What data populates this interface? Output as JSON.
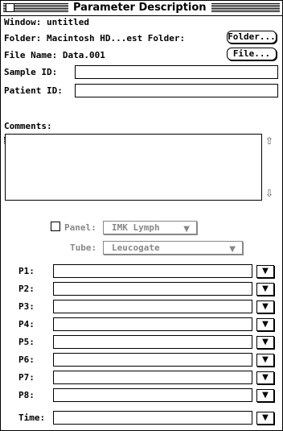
{
  "window": {
    "title": "Parameter Description"
  },
  "info": {
    "window_label": "Window: untitled",
    "folder_label": "Folder: Macintosh HD...est Folder:",
    "folder_button": "Folder...",
    "file_label": "File Name: Data.001",
    "file_button": "File..."
  },
  "fields": {
    "sample_id_label": "Sample ID:",
    "sample_id_value": "",
    "patient_id_label": "Patient ID:",
    "patient_id_value": "",
    "comments_label": "Comments:",
    "comments_value": ""
  },
  "panel": {
    "checkbox_checked": false,
    "panel_label": "Panel:",
    "panel_value": "IMK Lymph",
    "tube_label": "Tube:",
    "tube_value": "Leucogate"
  },
  "parameters": [
    {
      "label": "P1:",
      "value": ""
    },
    {
      "label": "P2:",
      "value": ""
    },
    {
      "label": "P3:",
      "value": ""
    },
    {
      "label": "P4:",
      "value": ""
    },
    {
      "label": "P5:",
      "value": ""
    },
    {
      "label": "P6:",
      "value": ""
    },
    {
      "label": "P7:",
      "value": ""
    },
    {
      "label": "P8:",
      "value": ""
    },
    {
      "label": "Time:",
      "value": ""
    }
  ],
  "icons": {
    "scroll_up": "up-arrow-icon",
    "scroll_down": "down-arrow-icon",
    "dropdown": "down-triangle-icon"
  }
}
